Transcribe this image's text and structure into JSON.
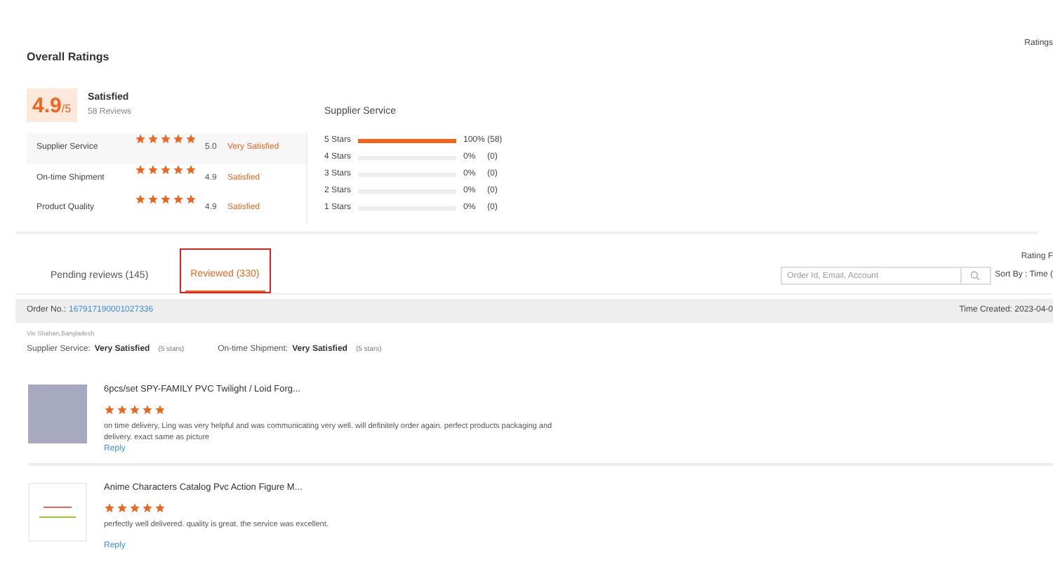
{
  "header": {
    "title": "Overall Ratings",
    "corner_label": "Ratings"
  },
  "summary": {
    "score": "4.9",
    "unit": "/5",
    "verdict": "Satisfied",
    "reviews": "58 Reviews"
  },
  "criteria": [
    {
      "name": "Supplier Service",
      "stars": 5,
      "score": "5.0",
      "verdict": "Very Satisfied"
    },
    {
      "name": "On-time Shipment",
      "stars": 5,
      "score": "4.9",
      "verdict": "Satisfied"
    },
    {
      "name": "Product Quality",
      "stars": 5,
      "score": "4.9",
      "verdict": "Satisfied"
    }
  ],
  "distribution": {
    "title": "Supplier Service",
    "rows": [
      {
        "label": "5 Stars",
        "level": 1,
        "percent": "100%",
        "count": "(58)"
      },
      {
        "label": "4 Stars",
        "level": 0,
        "percent": "0%",
        "count": "(0)"
      },
      {
        "label": "3 Stars",
        "level": 0,
        "percent": "0%",
        "count": "(0)"
      },
      {
        "label": "2 Stars",
        "level": 0,
        "percent": "0%",
        "count": "(0)"
      },
      {
        "label": "1 Stars",
        "level": 0,
        "percent": "0%",
        "count": "(0)"
      }
    ]
  },
  "tabs": [
    {
      "label": "Pending reviews (145)",
      "selected": false,
      "highlighted": false
    },
    {
      "label": "Reviewed (330)",
      "selected": true,
      "highlighted": true
    }
  ],
  "toolbar": {
    "rating_filter": "Rating F",
    "search_placeholder": "Order Id, Email, Account",
    "sort": "Sort By : Time ("
  },
  "order": {
    "label": "Order No.:",
    "number": "167917190001027336",
    "time": "Time Created: 2023-04-0",
    "buyer": "Vie Shahan,Bangladesh",
    "ratings": [
      {
        "name": "Supplier Service:",
        "verdict": "Very Satisfied",
        "stars": "(5 stars)"
      },
      {
        "name": "On-time Shipment:",
        "verdict": "Very Satisfied",
        "stars": "(5 stars)"
      }
    ]
  },
  "reviews": [
    {
      "kind": "photo",
      "title": "6pcs/set SPY-FAMILY PVC Twilight / Loid Forg...",
      "stars": 5,
      "text": "on time delivery, Ling was very helpful and was communicating very well. will definitely order again. perfect products packaging and delivery. exact same as picture",
      "reply": "Reply"
    },
    {
      "kind": "catalog",
      "title": "Anime Characters Catalog Pvc Action Figure M...",
      "stars": 5,
      "text": "perfectly well delivered. quality is great. the service was excellent.",
      "reply": "Reply"
    }
  ]
}
